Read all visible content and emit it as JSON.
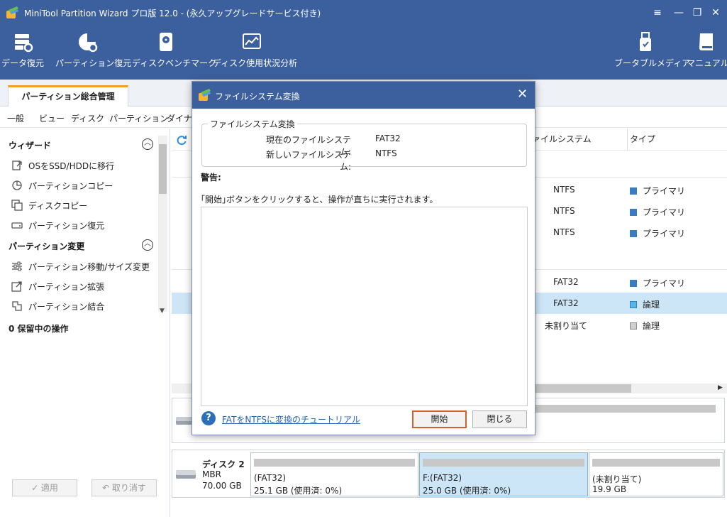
{
  "window": {
    "title": "MiniTool Partition Wizard プロ版 12.0 - (永久アップグレードサービス付き)",
    "controls": [
      "≡",
      "—",
      "❐",
      "✕"
    ]
  },
  "toolbar": {
    "left": [
      {
        "label": "データ復元",
        "icon": "data-recovery-icon"
      },
      {
        "label": "パーティション復元",
        "icon": "partition-recovery-icon"
      },
      {
        "label": "ディスクベンチマーク",
        "icon": "disk-benchmark-icon"
      },
      {
        "label": "ディスク使用状況分析",
        "icon": "space-analyzer-icon"
      }
    ],
    "right": [
      {
        "label": "ブータブルメディア",
        "icon": "bootable-media-icon"
      },
      {
        "label": "マニュアル",
        "icon": "manual-icon"
      }
    ]
  },
  "tabs": {
    "active": "パーティション総合管理"
  },
  "menu": [
    "一般",
    "ビュー",
    "ディスク",
    "パーティション",
    "ダイナミ"
  ],
  "sidebar": {
    "wizard_title": "ウィザード",
    "wizard_items": [
      "OSをSSD/HDDに移行",
      "パーティションコピー",
      "ディスクコピー",
      "パーティション復元"
    ],
    "change_title": "パーティション変更",
    "change_items": [
      "パーティション移動/サイズ変更",
      "パーティション拡張",
      "パーティション結合"
    ],
    "pending": "0 保留中の操作",
    "apply_label": "✓  適用",
    "undo_label": "↶  取り消す"
  },
  "table": {
    "headers": {
      "filesystem": "ァイルシステム",
      "type": "タイプ"
    },
    "rows": [
      {
        "fs": "NTFS",
        "type": "プライマリ",
        "color": "#3b7bbf"
      },
      {
        "fs": "NTFS",
        "type": "プライマリ",
        "color": "#3b7bbf"
      },
      {
        "fs": "NTFS",
        "type": "プライマリ",
        "color": "#3b7bbf"
      },
      {
        "fs": "FAT32",
        "type": "プライマリ",
        "color": "#3b7bbf"
      },
      {
        "fs": "FAT32",
        "type": "論理",
        "color": "#58b6e6"
      },
      {
        "fs": "未割り当て",
        "type": "論理",
        "color": "#cfcfcf"
      }
    ]
  },
  "disk2": {
    "name": "ディスク 2",
    "style": "MBR",
    "size": "70.00 GB",
    "partitions": [
      {
        "name": "(FAT32)",
        "info": "25.1 GB (使用済: 0%)"
      },
      {
        "name": "F:(FAT32)",
        "info": "25.0 GB (使用済: 0%)"
      },
      {
        "name": "(未割り当て)",
        "info": "19.9 GB"
      }
    ]
  },
  "dialog": {
    "title": "ファイルシステム変換",
    "group_title": "ファイルシステム変換",
    "current_label": "現在のファイルシステム:",
    "current_value": "FAT32",
    "new_label": "新しいファイルシステム:",
    "new_value": "NTFS",
    "warning_title": "警告:",
    "warning_text": "｢開始｣ボタンをクリックすると、操作が直ちに実行されます。",
    "help_icon": "?",
    "tutorial_link": "FATをNTFSに変換のチュートリアル",
    "start_label": "開始",
    "close_label": "閉じる"
  },
  "colors": {
    "titlebar": "#3c5f9e",
    "accent": "#f0a31c",
    "selection": "#cde6f7",
    "link": "#2466b6"
  }
}
